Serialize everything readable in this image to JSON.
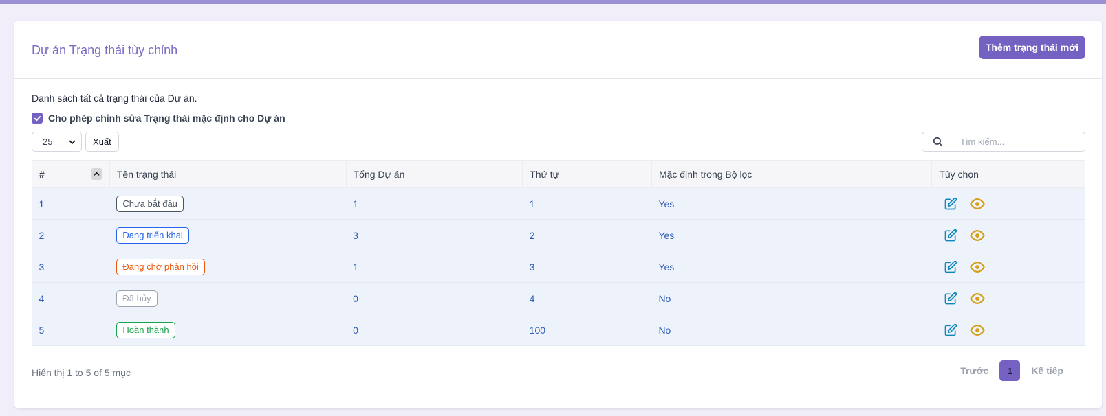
{
  "header": {
    "title": "Dự án Trạng thái tùy chỉnh",
    "add_button": "Thêm trạng thái mới"
  },
  "description": "Danh sách tất cả trạng thái của Dự án.",
  "allow_edit": {
    "label": "Cho phép chỉnh sửa Trạng thái mặc định cho Dự án",
    "checked": true
  },
  "controls": {
    "page_size": "25",
    "export_label": "Xuất",
    "search_placeholder": "Tìm kiếm..."
  },
  "table": {
    "columns": [
      "#",
      "Tên trạng thái",
      "Tổng Dự án",
      "Thứ tự",
      "Mặc định trong Bộ lọc",
      "Tùy chọn"
    ],
    "rows": [
      {
        "id": "1",
        "name": "Chưa bắt đầu",
        "total": "1",
        "order": "1",
        "default": "Yes",
        "color": "#4b5563"
      },
      {
        "id": "2",
        "name": "Đang triển khai",
        "total": "3",
        "order": "2",
        "default": "Yes",
        "color": "#2563eb"
      },
      {
        "id": "3",
        "name": "Đang chờ phản hồi",
        "total": "1",
        "order": "3",
        "default": "Yes",
        "color": "#ea580c"
      },
      {
        "id": "4",
        "name": "Đã hủy",
        "total": "0",
        "order": "4",
        "default": "No",
        "color": "#9ca3af"
      },
      {
        "id": "5",
        "name": "Hoàn thành",
        "total": "0",
        "order": "100",
        "default": "No",
        "color": "#16a34a"
      }
    ]
  },
  "footer": {
    "info": "Hiển thị 1 to 5 of 5 mục",
    "prev": "Trước",
    "page": "1",
    "next": "Kế tiếp"
  },
  "colors": {
    "accent": "#7461c2",
    "edit_icon": "#0e86b8",
    "view_icon": "#d4a017"
  },
  "icons": {
    "edit": "pencil-square-icon",
    "view": "eye-icon",
    "search": "search-icon",
    "sort": "chevron-up-icon",
    "dropdown": "chevron-down-icon",
    "checkbox": "checkmark-icon"
  }
}
